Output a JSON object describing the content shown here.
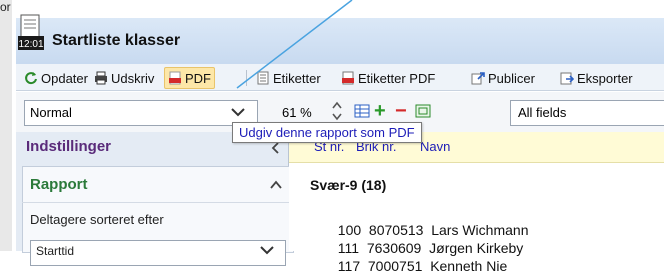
{
  "background": {
    "top_text": "or"
  },
  "window": {
    "title": "Startliste klasser",
    "icon_time": "12:01"
  },
  "toolbar": {
    "update_label": "Opdater",
    "print_label": "Udskriv",
    "pdf_label": "PDF",
    "labels_label": "Etiketter",
    "labels_pdf_label": "Etiketter PDF",
    "publish_label": "Publicer",
    "export_label": "Eksporter"
  },
  "controls": {
    "view_select": "Normal",
    "zoom": "61 %",
    "fields_select": "All fields"
  },
  "tooltip": {
    "text": "Udgiv denne rapport som PDF"
  },
  "left_panel": {
    "settings_title": "Indstillinger",
    "report_title": "Rapport",
    "sort_label": "Deltagere sorteret efter",
    "sort_value": "Starttid"
  },
  "table": {
    "col_start": "St nr.",
    "col_card": "Brik nr.",
    "col_name": "Navn",
    "class_title": "Svær-9  (18)",
    "rows": [
      {
        "start": "100",
        "card": "8070513",
        "name": "Lars Wichmann"
      },
      {
        "start": "111",
        "card": "7630609",
        "name": "Jørgen Kirkeby"
      },
      {
        "start": "117",
        "card": "7000751",
        "name": "Kenneth Nie"
      }
    ]
  },
  "colors": {
    "accent_blue": "#1c1cb8",
    "settings_purple": "#5a2b7a",
    "report_green": "#2b7a3a",
    "pdf_highlight": "#fde7a8"
  }
}
